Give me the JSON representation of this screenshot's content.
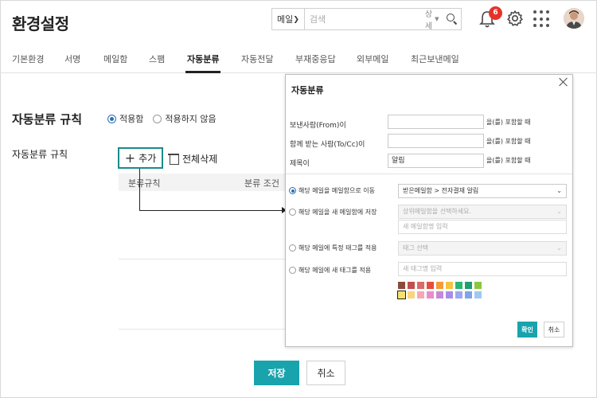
{
  "header": {
    "title": "환경설정",
    "search": {
      "scope_value": "메일",
      "placeholder": "검색",
      "detail_label": "상세"
    },
    "notifications": {
      "count": "6"
    }
  },
  "tabs": [
    {
      "label": "기본환경"
    },
    {
      "label": "서명"
    },
    {
      "label": "메일함"
    },
    {
      "label": "스팸"
    },
    {
      "label": "자동분류"
    },
    {
      "label": "자동전달"
    },
    {
      "label": "부재중응답"
    },
    {
      "label": "외부메일"
    },
    {
      "label": "최근보낸메일"
    }
  ],
  "main": {
    "rule_title": "자동분류 규칙",
    "radio_apply": "적용함",
    "radio_not_apply": "적용하지 않음",
    "rule_list_label": "자동분류 규칙",
    "add_label": "추가",
    "delete_all_label": "전체삭제",
    "table_headers": [
      "분류규칙",
      "분류 조건"
    ],
    "save_label": "저장",
    "cancel_label": "취소"
  },
  "dialog": {
    "title": "자동분류",
    "fields": [
      {
        "label": "보낸사람(From)이",
        "value": "",
        "suffix": "을(를) 포함할 때"
      },
      {
        "label": "함께 받는 사람(To/Cc)이",
        "value": "",
        "suffix": "을(를) 포함할 때"
      },
      {
        "label": "제목이",
        "value": "알림",
        "suffix": "을(를) 포함할 때"
      }
    ],
    "actions": {
      "move_label": "해당 메일을 메일함으로 이동",
      "move_select": "받은메일함 > 전자결재 알림",
      "new_box_label": "해당 메일을 새 메일함에 저장",
      "new_box_select_placeholder": "상위메일함을 선택하세요.",
      "new_box_name_placeholder": "새 메일함명 입력",
      "tag_label": "해당 메일에 특정 태그를 적용",
      "tag_select_placeholder": "태그 선택",
      "new_tag_label": "해당 메일에 새 태그를 적용",
      "new_tag_placeholder": "새 태그명 입력"
    },
    "colors_row1": [
      "#8b4a3c",
      "#c0504d",
      "#d96b6b",
      "#e84c3d",
      "#f39c3a",
      "#f5c342",
      "#2bb673",
      "#1f9e6f",
      "#8dc63f"
    ],
    "colors_row2": [
      "#f6e26b",
      "#f8d57e",
      "#f6a7b6",
      "#e98cc9",
      "#c589d8",
      "#a68ee8",
      "#9fa7f2",
      "#7fa5e8",
      "#9fc9f0"
    ],
    "ok_label": "확인",
    "cancel_label": "취소"
  },
  "colors": {
    "accent": "#19a3ad",
    "highlight_border": "#1b8a8a",
    "badge": "#e5332a",
    "radio": "#2a6fb5"
  }
}
